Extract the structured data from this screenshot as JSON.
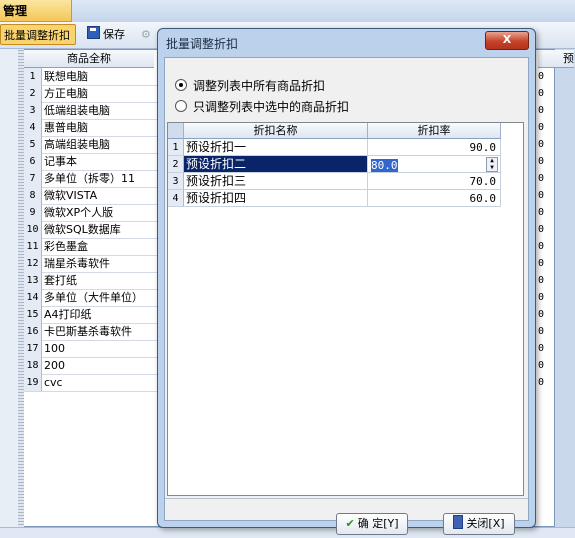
{
  "app": {
    "title": "管理",
    "toolbar": {
      "batch_discount_label": "批量调整折扣",
      "save_label": "保存"
    },
    "grid": {
      "header_name": "商品全称",
      "header_right": "预",
      "rows": [
        {
          "num": "1",
          "name": "联想电脑"
        },
        {
          "num": "2",
          "name": "方正电脑"
        },
        {
          "num": "3",
          "name": "低端组装电脑"
        },
        {
          "num": "4",
          "name": "惠普电脑"
        },
        {
          "num": "5",
          "name": "高端组装电脑"
        },
        {
          "num": "6",
          "name": "记事本"
        },
        {
          "num": "7",
          "name": "多单位（拆零）11"
        },
        {
          "num": "8",
          "name": "微软VISTA"
        },
        {
          "num": "9",
          "name": "微软XP个人版"
        },
        {
          "num": "10",
          "name": "微软SQL数据库"
        },
        {
          "num": "11",
          "name": "彩色墨盒"
        },
        {
          "num": "12",
          "name": "瑞星杀毒软件"
        },
        {
          "num": "13",
          "name": "套打纸"
        },
        {
          "num": "14",
          "name": "多单位（大件单位）"
        },
        {
          "num": "15",
          "name": "A4打印纸"
        },
        {
          "num": "16",
          "name": "卡巴斯基杀毒软件"
        },
        {
          "num": "17",
          "name": "100"
        },
        {
          "num": "18",
          "name": "200"
        },
        {
          "num": "19",
          "name": "cvc"
        }
      ],
      "right_cells": [
        "0",
        "0",
        "0",
        "0",
        "0",
        "0",
        "0",
        "0",
        "0",
        "0",
        "0",
        "0",
        "0",
        "0",
        "0",
        "0",
        "0",
        "0",
        "0"
      ]
    }
  },
  "dialog": {
    "title": "批量调整折扣",
    "close_label": "X",
    "radio_all": "调整列表中所有商品折扣",
    "radio_selected": "只调整列表中选中的商品折扣",
    "table": {
      "col_name": "折扣名称",
      "col_rate": "折扣率",
      "rows": [
        {
          "num": "1",
          "name": "预设折扣一",
          "rate": "90.0"
        },
        {
          "num": "2",
          "name": "预设折扣二",
          "rate": "80.0"
        },
        {
          "num": "3",
          "name": "预设折扣三",
          "rate": "70.0"
        },
        {
          "num": "4",
          "name": "预设折扣四",
          "rate": "60.0"
        }
      ]
    },
    "ok_label": "确 定[Y]",
    "close_button_label": "关闭[X]"
  }
}
